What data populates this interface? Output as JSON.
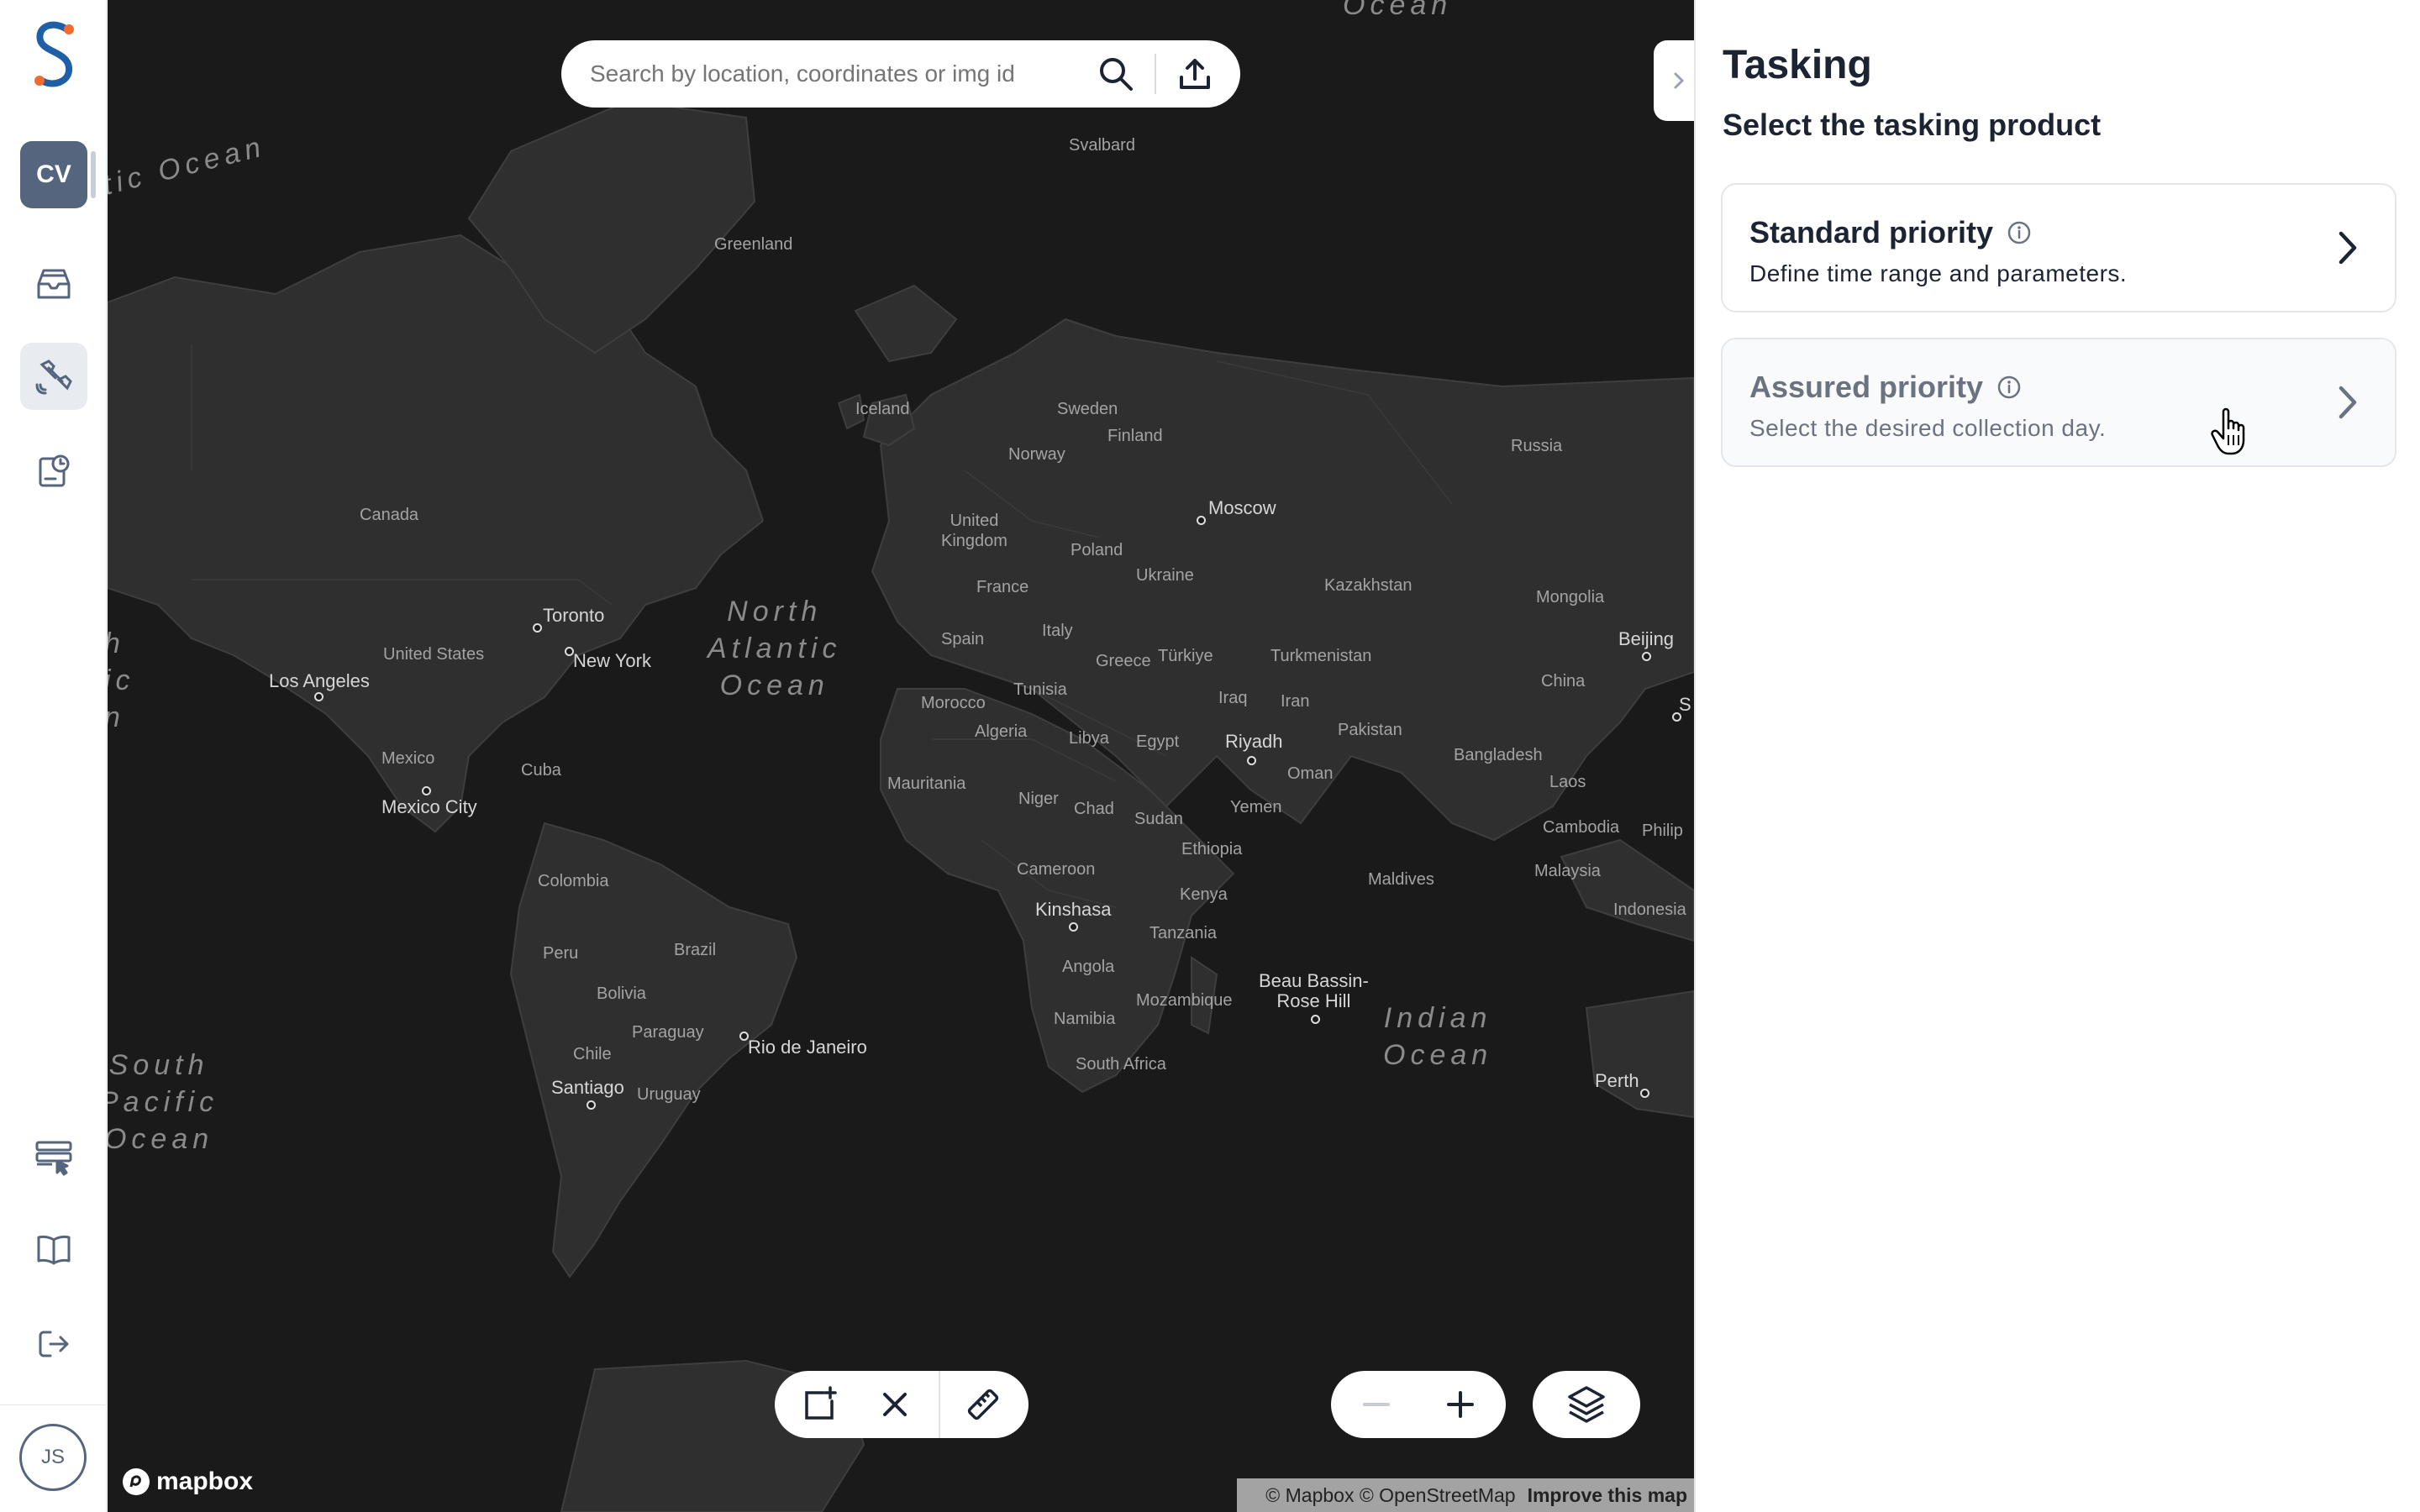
{
  "sidebar": {
    "logo": "logo-s",
    "workspace_initials": "CV",
    "user_initials": "JS",
    "icons": [
      "inbox-icon",
      "satellite-icon",
      "clock-report-icon",
      "settings-cursor-icon",
      "book-icon",
      "logout-icon"
    ]
  },
  "search": {
    "placeholder": "Search by location, coordinates or img id"
  },
  "map": {
    "labels": {
      "svalbard": "Svalbard",
      "greenland": "Greenland",
      "iceland": "Iceland",
      "sweden": "Sweden",
      "norway": "Norway",
      "finland": "Finland",
      "russia": "Russia",
      "moscow": "Moscow",
      "canada": "Canada",
      "united_kingdom": "United\nKingdom",
      "poland": "Poland",
      "ukraine": "Ukraine",
      "france": "France",
      "kazakhstan": "Kazakhstan",
      "mongolia": "Mongolia",
      "toronto": "Toronto",
      "new_york": "New York",
      "united_states": "United States",
      "los_angeles": "Los Angeles",
      "spain": "Spain",
      "italy": "Italy",
      "greece": "Greece",
      "turkiye": "Türkiye",
      "turkmenistan": "Turkmenistan",
      "beijing": "Beijing",
      "china": "China",
      "tunisia": "Tunisia",
      "morocco": "Morocco",
      "iraq": "Iraq",
      "iran": "Iran",
      "pakistan": "Pakistan",
      "algeria": "Algeria",
      "libya": "Libya",
      "egypt": "Egypt",
      "riyadh": "Riyadh",
      "oman": "Oman",
      "bangladesh": "Bangladesh",
      "mexico": "Mexico",
      "cuba": "Cuba",
      "mexico_city": "Mexico City",
      "mauritania": "Mauritania",
      "niger": "Niger",
      "chad": "Chad",
      "sudan": "Sudan",
      "yemen": "Yemen",
      "laos": "Laos",
      "ethiopia": "Ethiopia",
      "cambodia": "Cambodia",
      "philippines": "Philip",
      "colombia": "Colombia",
      "cameroon": "Cameroon",
      "kenya": "Kenya",
      "maldives": "Maldives",
      "malaysia": "Malaysia",
      "indonesia": "Indonesia",
      "kinshasa": "Kinshasa",
      "tanzania": "Tanzania",
      "brazil": "Brazil",
      "peru": "Peru",
      "angola": "Angola",
      "bolivia": "Bolivia",
      "beau_bassin": "Beau Bassin-\nRose Hill",
      "namibia": "Namibia",
      "mozambique": "Mozambique",
      "paraguay": "Paraguay",
      "rio": "Rio de Janeiro",
      "chile": "Chile",
      "south_africa": "South Africa",
      "santiago": "Santiago",
      "uruguay": "Uruguay",
      "perth": "Perth",
      "s_label": "S"
    },
    "oceans": {
      "north_atlantic": "North\nAtlantic\nOcean",
      "indian": "Indian\nOcean",
      "south_pacific": "South\nPacific\nOcean",
      "pacific_top": "tic Ocean",
      "pacific_left": "h\nic\nn",
      "arctic_top": "Ocean"
    },
    "attribution": "© Mapbox © OpenStreetMap",
    "improve": "Improve this map",
    "mapbox_logo": "mapbox"
  },
  "toolbar": {
    "draw_icon": "add-rectangle-icon",
    "clear_icon": "close-icon",
    "measure_icon": "ruler-icon"
  },
  "zoom": {
    "out_icon": "minus-icon",
    "in_icon": "plus-icon",
    "layers_icon": "layers-icon"
  },
  "panel": {
    "title": "Tasking",
    "subtitle": "Select the tasking product",
    "options": [
      {
        "title": "Standard priority",
        "description": "Define time range and parameters."
      },
      {
        "title": "Assured priority",
        "description": "Select the desired collection day."
      }
    ]
  },
  "colors": {
    "accent_blue": "#1f5fa8",
    "accent_orange": "#f26b2e",
    "workspace_badge": "#56657e",
    "map_bg": "#1a1a1a",
    "land": "#2f2f2f"
  }
}
